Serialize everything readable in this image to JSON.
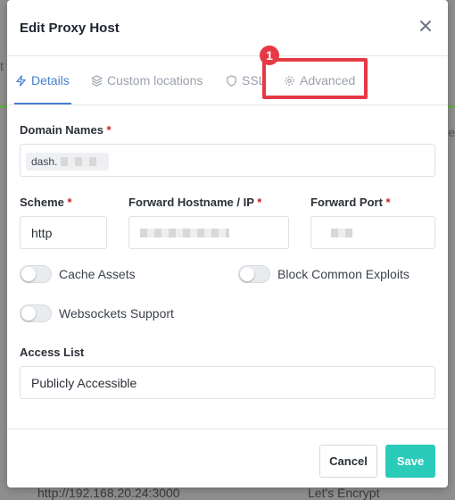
{
  "background": {
    "left_char": "t",
    "right_char": "e",
    "bottom_left": "http://192.168.20.24:3000",
    "bottom_right": "Let's Encrypt"
  },
  "modal": {
    "title": "Edit Proxy Host",
    "close_icon": "close-icon"
  },
  "tabs": [
    {
      "label": "Details",
      "icon": "bolt-icon",
      "active": true
    },
    {
      "label": "Custom locations",
      "icon": "layers-icon",
      "active": false
    },
    {
      "label": "SSL",
      "icon": "shield-icon",
      "active": false
    },
    {
      "label": "Advanced",
      "icon": "gear-icon",
      "active": false
    }
  ],
  "annotation": {
    "badge": "1",
    "color": "#e53945"
  },
  "form": {
    "domain_names_label": "Domain Names",
    "domain_tag_prefix": "dash.",
    "required_mark": "*",
    "scheme_label": "Scheme",
    "scheme_value": "http",
    "forward_host_label": "Forward Hostname / IP",
    "forward_port_label": "Forward Port",
    "cache_assets_label": "Cache Assets",
    "block_exploits_label": "Block Common Exploits",
    "websockets_label": "Websockets Support",
    "access_list_label": "Access List",
    "access_list_value": "Publicly Accessible"
  },
  "footer": {
    "cancel_label": "Cancel",
    "save_label": "Save"
  },
  "colors": {
    "accent": "#467fcf",
    "save": "#2bcbba",
    "required": "#cd201f"
  }
}
